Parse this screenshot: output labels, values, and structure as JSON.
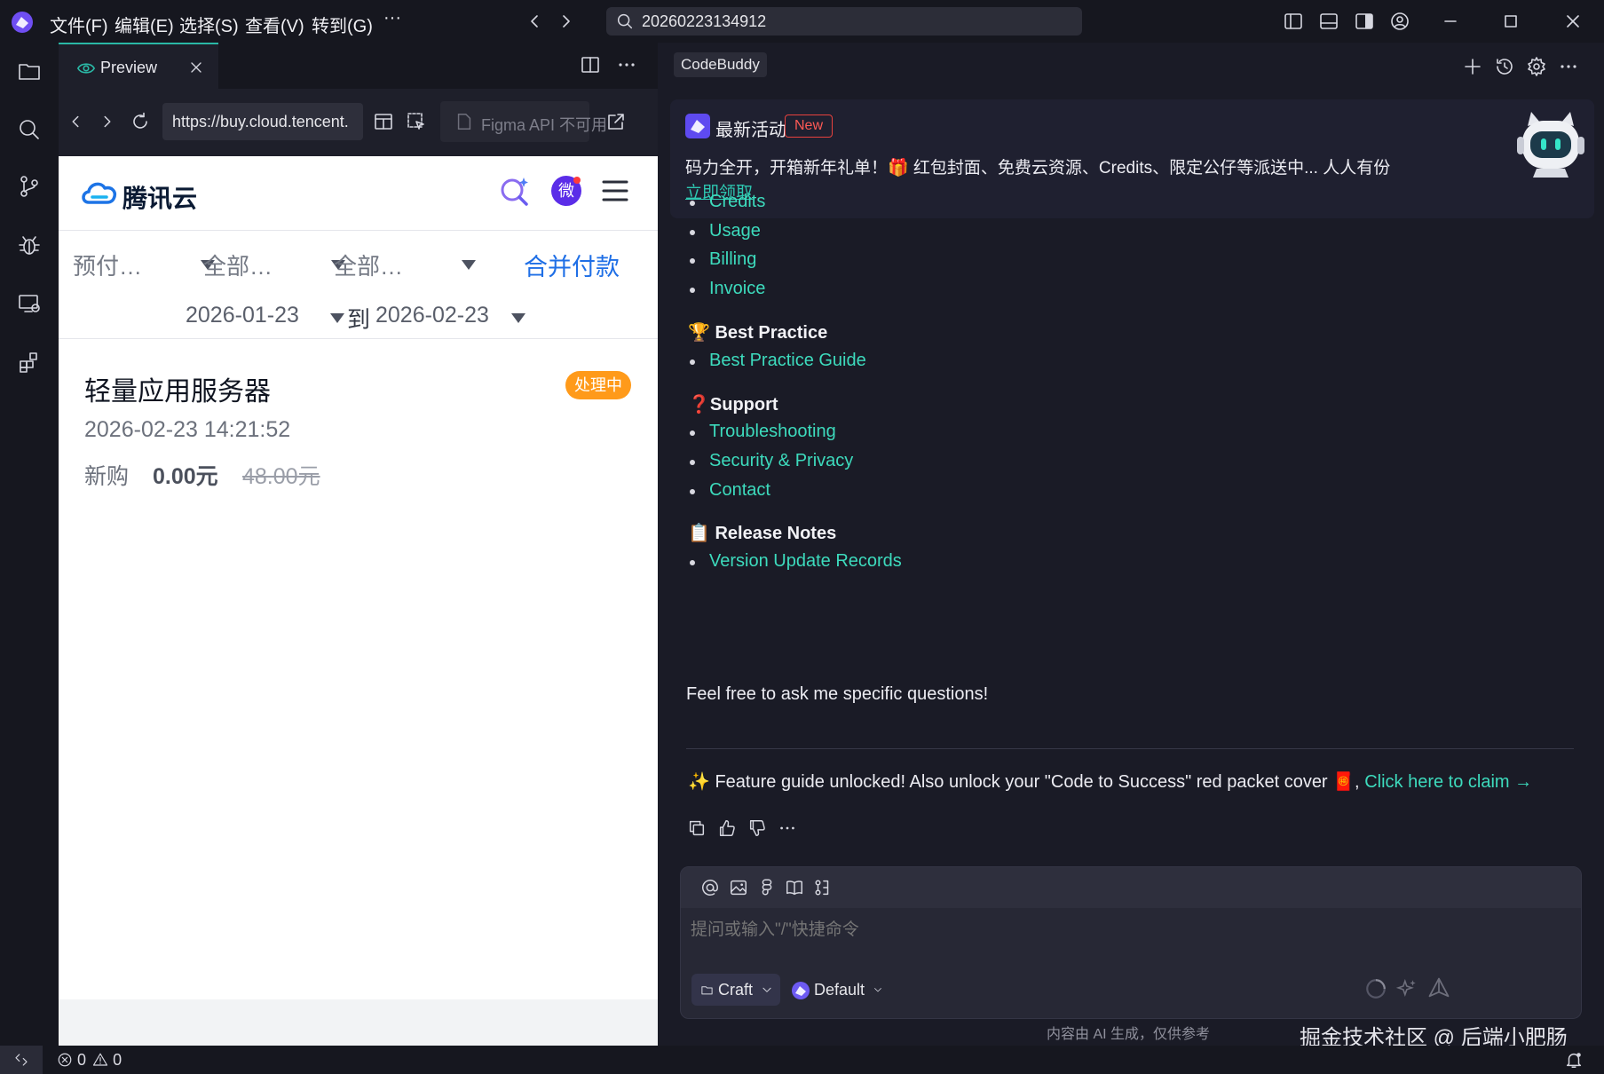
{
  "titlebar": {
    "menus": [
      "文件(F)",
      "编辑(E)",
      "选择(S)",
      "查看(V)",
      "转到(G)"
    ],
    "more": "···",
    "search_value": "20260223134912"
  },
  "preview": {
    "tab_label": "Preview",
    "url": "https://buy.cloud.tencent.",
    "figma_status": "Figma API 不可用"
  },
  "web": {
    "brand": "腾讯云",
    "avatar_char": "微",
    "filters": [
      "预付…",
      "全部…",
      "全部…"
    ],
    "merge_pay": "合并付款",
    "date_from": "2026-01-23",
    "date_to_label": "到",
    "date_to": "2026-02-23",
    "order": {
      "title": "轻量应用服务器",
      "status": "处理中",
      "time": "2026-02-23 14:21:52",
      "type": "新购",
      "price": "0.00元",
      "original_price": "48.00元"
    }
  },
  "assistant": {
    "tab_label": "CodeBuddy",
    "banner": {
      "title": "最新活动",
      "badge": "New",
      "text": "码力全开，开箱新年礼单！🎁 红包封面、免费云资源、Credits、限定公仔等派送中... 人人有份",
      "link": "立即领取"
    },
    "billing_items": [
      "Credits",
      "Usage",
      "Billing",
      "Invoice"
    ],
    "best_practice": {
      "icon": "🏆",
      "title": "Best Practice",
      "items": [
        "Best Practice Guide"
      ]
    },
    "support": {
      "icon": "❓",
      "title": "Support",
      "items": [
        "Troubleshooting",
        "Security & Privacy",
        "Contact"
      ]
    },
    "release_notes": {
      "icon": "📋",
      "title": "Release Notes",
      "items": [
        "Version Update Records"
      ]
    },
    "ask_text": "Feel free to ask me specific questions!",
    "feature_text": "✨ Feature guide unlocked! Also unlock your \"Code to Success\" red packet cover 🧧,",
    "feature_link": "Click here to claim →",
    "input_placeholder": "提问或输入\"/\"快捷命令",
    "mode": "Craft",
    "model": "Default",
    "disclaimer": "内容由 AI 生成，仅供参考"
  },
  "watermark": "掘金技术社区 @ 后端小肥肠",
  "statusbar": {
    "errors": "0",
    "warnings": "0"
  },
  "colors": {
    "accent": "#2ab8a6",
    "link": "#3ddbbd",
    "brand_blue": "#1f6fe6",
    "status_orange": "#ff9a1a"
  }
}
